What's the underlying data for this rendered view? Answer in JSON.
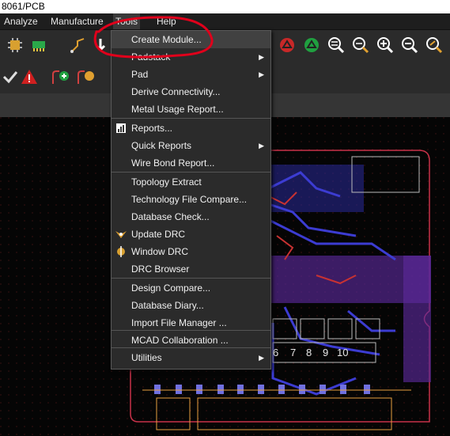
{
  "title": "8061/PCB",
  "menubar": {
    "items": [
      "Analyze",
      "Manufacture",
      "Tools",
      "Help"
    ]
  },
  "toolbar": {
    "left_icons": [
      "component-icon",
      "place-icon",
      "route-icon",
      "check-icon",
      "warning-icon"
    ],
    "right_icons": [
      "zoom-fit-icon",
      "zoom-in-icon",
      "zoom-out-icon",
      "zoom-previous-icon"
    ]
  },
  "tools_menu": {
    "items": [
      {
        "label": "Create Module...",
        "submenu": false
      },
      {
        "label": "Padstack",
        "submenu": true
      },
      {
        "label": "Pad",
        "submenu": true
      },
      {
        "label": "Derive Connectivity...",
        "submenu": false
      },
      {
        "label": "Metal Usage Report...",
        "submenu": false
      },
      {
        "label": "Reports...",
        "submenu": false
      },
      {
        "label": "Quick Reports",
        "submenu": true
      },
      {
        "label": "Wire Bond Report...",
        "submenu": false
      },
      {
        "label": "Topology Extract",
        "submenu": false
      },
      {
        "label": "Technology File Compare...",
        "submenu": false
      },
      {
        "label": "Database Check...",
        "submenu": false
      },
      {
        "label": "Update DRC",
        "submenu": false
      },
      {
        "label": "Window DRC",
        "submenu": false
      },
      {
        "label": "DRC Browser",
        "submenu": false
      },
      {
        "label": "Design Compare...",
        "submenu": false
      },
      {
        "label": "Database Diary...",
        "submenu": false
      },
      {
        "label": "Import File Manager ...",
        "submenu": false
      },
      {
        "label": "MCAD Collaboration ...",
        "submenu": false
      },
      {
        "label": "Utilities",
        "submenu": true
      }
    ]
  },
  "canvas": {
    "pin_labels": [
      "6",
      "7",
      "8",
      "9",
      "10"
    ]
  },
  "colors": {
    "annotation": "#e0001b",
    "board_outline": "#c8324a",
    "copper": "#3c3cd2",
    "silkscreen": "#e8a040",
    "highlight_zone": "#5a2a9a"
  }
}
